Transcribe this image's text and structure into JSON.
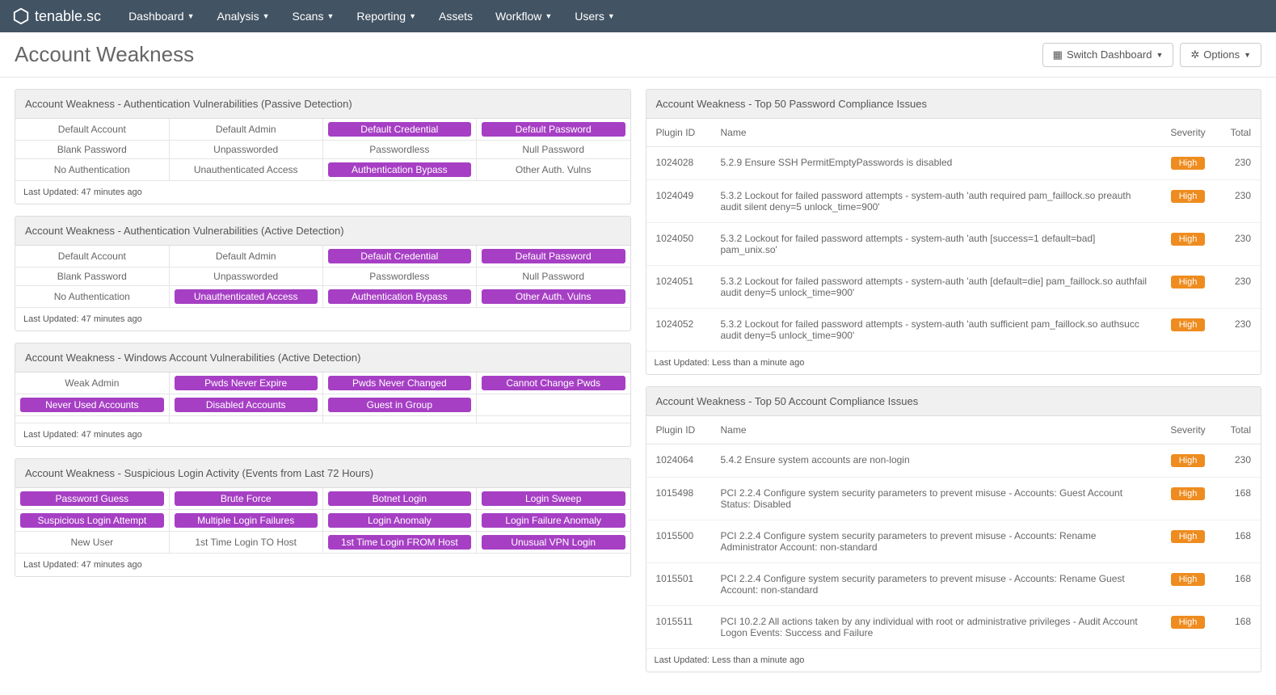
{
  "brand": "tenable.sc",
  "nav": [
    "Dashboard",
    "Analysis",
    "Scans",
    "Reporting",
    "Assets",
    "Workflow",
    "Users"
  ],
  "nav_caret": [
    true,
    true,
    true,
    true,
    false,
    true,
    true
  ],
  "page_title": "Account Weakness",
  "buttons": {
    "switch": "Switch Dashboard",
    "options": "Options"
  },
  "updated_47": "Last Updated: 47 minutes ago",
  "updated_lt1": "Last Updated: Less than a minute ago",
  "panels_left": [
    {
      "title": "Account Weakness - Authentication Vulnerabilities (Passive Detection)",
      "rows": [
        [
          {
            "t": "Default Account",
            "h": false
          },
          {
            "t": "Default Admin",
            "h": false
          },
          {
            "t": "Default Credential",
            "h": true
          },
          {
            "t": "Default Password",
            "h": true
          }
        ],
        [
          {
            "t": "Blank Password",
            "h": false
          },
          {
            "t": "Unpassworded",
            "h": false
          },
          {
            "t": "Passwordless",
            "h": false
          },
          {
            "t": "Null Password",
            "h": false
          }
        ],
        [
          {
            "t": "No Authentication",
            "h": false
          },
          {
            "t": "Unauthenticated Access",
            "h": false
          },
          {
            "t": "Authentication Bypass",
            "h": true
          },
          {
            "t": "Other Auth. Vulns",
            "h": false
          }
        ]
      ]
    },
    {
      "title": "Account Weakness - Authentication Vulnerabilities (Active Detection)",
      "rows": [
        [
          {
            "t": "Default Account",
            "h": false
          },
          {
            "t": "Default Admin",
            "h": false
          },
          {
            "t": "Default Credential",
            "h": true
          },
          {
            "t": "Default Password",
            "h": true
          }
        ],
        [
          {
            "t": "Blank Password",
            "h": false
          },
          {
            "t": "Unpassworded",
            "h": false
          },
          {
            "t": "Passwordless",
            "h": false
          },
          {
            "t": "Null Password",
            "h": false
          }
        ],
        [
          {
            "t": "No Authentication",
            "h": false
          },
          {
            "t": "Unauthenticated Access",
            "h": true
          },
          {
            "t": "Authentication Bypass",
            "h": true
          },
          {
            "t": "Other Auth. Vulns",
            "h": true
          }
        ]
      ]
    },
    {
      "title": "Account Weakness - Windows Account Vulnerabilities (Active Detection)",
      "rows": [
        [
          {
            "t": "Weak Admin",
            "h": false
          },
          {
            "t": "Pwds Never Expire",
            "h": true
          },
          {
            "t": "Pwds Never Changed",
            "h": true
          },
          {
            "t": "Cannot Change Pwds",
            "h": true
          }
        ],
        [
          {
            "t": "Never Used Accounts",
            "h": true
          },
          {
            "t": "Disabled Accounts",
            "h": true
          },
          {
            "t": "Guest in Group",
            "h": true
          },
          {
            "t": "",
            "h": false
          }
        ],
        [
          {
            "t": "",
            "h": false
          },
          {
            "t": "",
            "h": false
          },
          {
            "t": "",
            "h": false
          },
          {
            "t": "",
            "h": false
          }
        ]
      ]
    },
    {
      "title": "Account Weakness - Suspicious Login Activity (Events from Last 72 Hours)",
      "rows": [
        [
          {
            "t": "Password Guess",
            "h": true
          },
          {
            "t": "Brute Force",
            "h": true
          },
          {
            "t": "Botnet Login",
            "h": true
          },
          {
            "t": "Login Sweep",
            "h": true
          }
        ],
        [
          {
            "t": "Suspicious Login Attempt",
            "h": true
          },
          {
            "t": "Multiple Login Failures",
            "h": true
          },
          {
            "t": "Login Anomaly",
            "h": true
          },
          {
            "t": "Login Failure Anomaly",
            "h": true
          }
        ],
        [
          {
            "t": "New User",
            "h": false
          },
          {
            "t": "1st Time Login TO Host",
            "h": false
          },
          {
            "t": "1st Time Login FROM Host",
            "h": true
          },
          {
            "t": "Unusual VPN Login",
            "h": true
          }
        ]
      ]
    }
  ],
  "table_headers": {
    "plugin": "Plugin ID",
    "name": "Name",
    "severity": "Severity",
    "total": "Total"
  },
  "severity_high": "High",
  "panels_right": [
    {
      "title": "Account Weakness - Top 50 Password Compliance Issues",
      "rows": [
        {
          "id": "1024028",
          "name": "5.2.9 Ensure SSH PermitEmptyPasswords is disabled",
          "total": "230"
        },
        {
          "id": "1024049",
          "name": "5.3.2 Lockout for failed password attempts - system-auth 'auth required pam_faillock.so preauth audit silent deny=5 unlock_time=900'",
          "total": "230"
        },
        {
          "id": "1024050",
          "name": "5.3.2 Lockout for failed password attempts - system-auth 'auth [success=1 default=bad] pam_unix.so'",
          "total": "230"
        },
        {
          "id": "1024051",
          "name": "5.3.2 Lockout for failed password attempts - system-auth 'auth [default=die] pam_faillock.so authfail audit deny=5 unlock_time=900'",
          "total": "230"
        },
        {
          "id": "1024052",
          "name": "5.3.2 Lockout for failed password attempts - system-auth 'auth sufficient pam_faillock.so authsucc audit deny=5 unlock_time=900'",
          "total": "230"
        }
      ]
    },
    {
      "title": "Account Weakness - Top 50 Account Compliance Issues",
      "rows": [
        {
          "id": "1024064",
          "name": "5.4.2 Ensure system accounts are non-login",
          "total": "230"
        },
        {
          "id": "1015498",
          "name": "PCI 2.2.4 Configure system security parameters to prevent misuse - Accounts: Guest Account Status: Disabled",
          "total": "168"
        },
        {
          "id": "1015500",
          "name": "PCI 2.2.4 Configure system security parameters to prevent misuse - Accounts: Rename Administrator Account: non-standard",
          "total": "168"
        },
        {
          "id": "1015501",
          "name": "PCI 2.2.4 Configure system security parameters to prevent misuse - Accounts: Rename Guest Account: non-standard",
          "total": "168"
        },
        {
          "id": "1015511",
          "name": "PCI 10.2.2 All actions taken by any individual with root or administrative privileges - Audit Account Logon Events: Success and Failure",
          "total": "168"
        }
      ]
    }
  ]
}
